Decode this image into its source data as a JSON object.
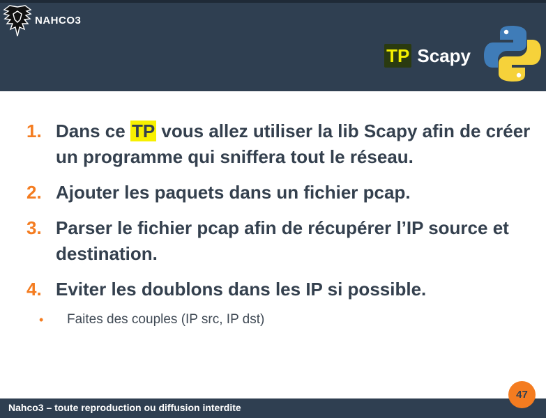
{
  "header": {
    "brand": "NAHCO3",
    "title_tag": "TP",
    "title_text": "Scapy"
  },
  "list": [
    {
      "num": "1.",
      "parts": [
        "Dans ce ",
        "TP",
        " vous allez utiliser la lib Scapy afin de créer un programme qui sniffera tout le réseau."
      ]
    },
    {
      "num": "2.",
      "text": "Ajouter les paquets dans un fichier pcap."
    },
    {
      "num": "3.",
      "text": "Parser le fichier pcap afin de récupérer l’IP source et destination."
    },
    {
      "num": "4.",
      "text": "Eviter les doublons dans les IP si possible."
    }
  ],
  "sub_bullet": {
    "marker": "•",
    "text": "Faites des couples (IP src, IP dst)"
  },
  "footer": {
    "text": "Nahco3 – toute reproduction ou diffusion interdite",
    "page_number": "47"
  },
  "colors": {
    "header_bg": "#2f3f51",
    "accent_orange": "#f47c20",
    "highlight_yellow": "#f7f000",
    "body_text": "#34404e"
  },
  "icons": {
    "brand_logo": "eagle-crest-icon",
    "python": "python-logo-icon"
  }
}
